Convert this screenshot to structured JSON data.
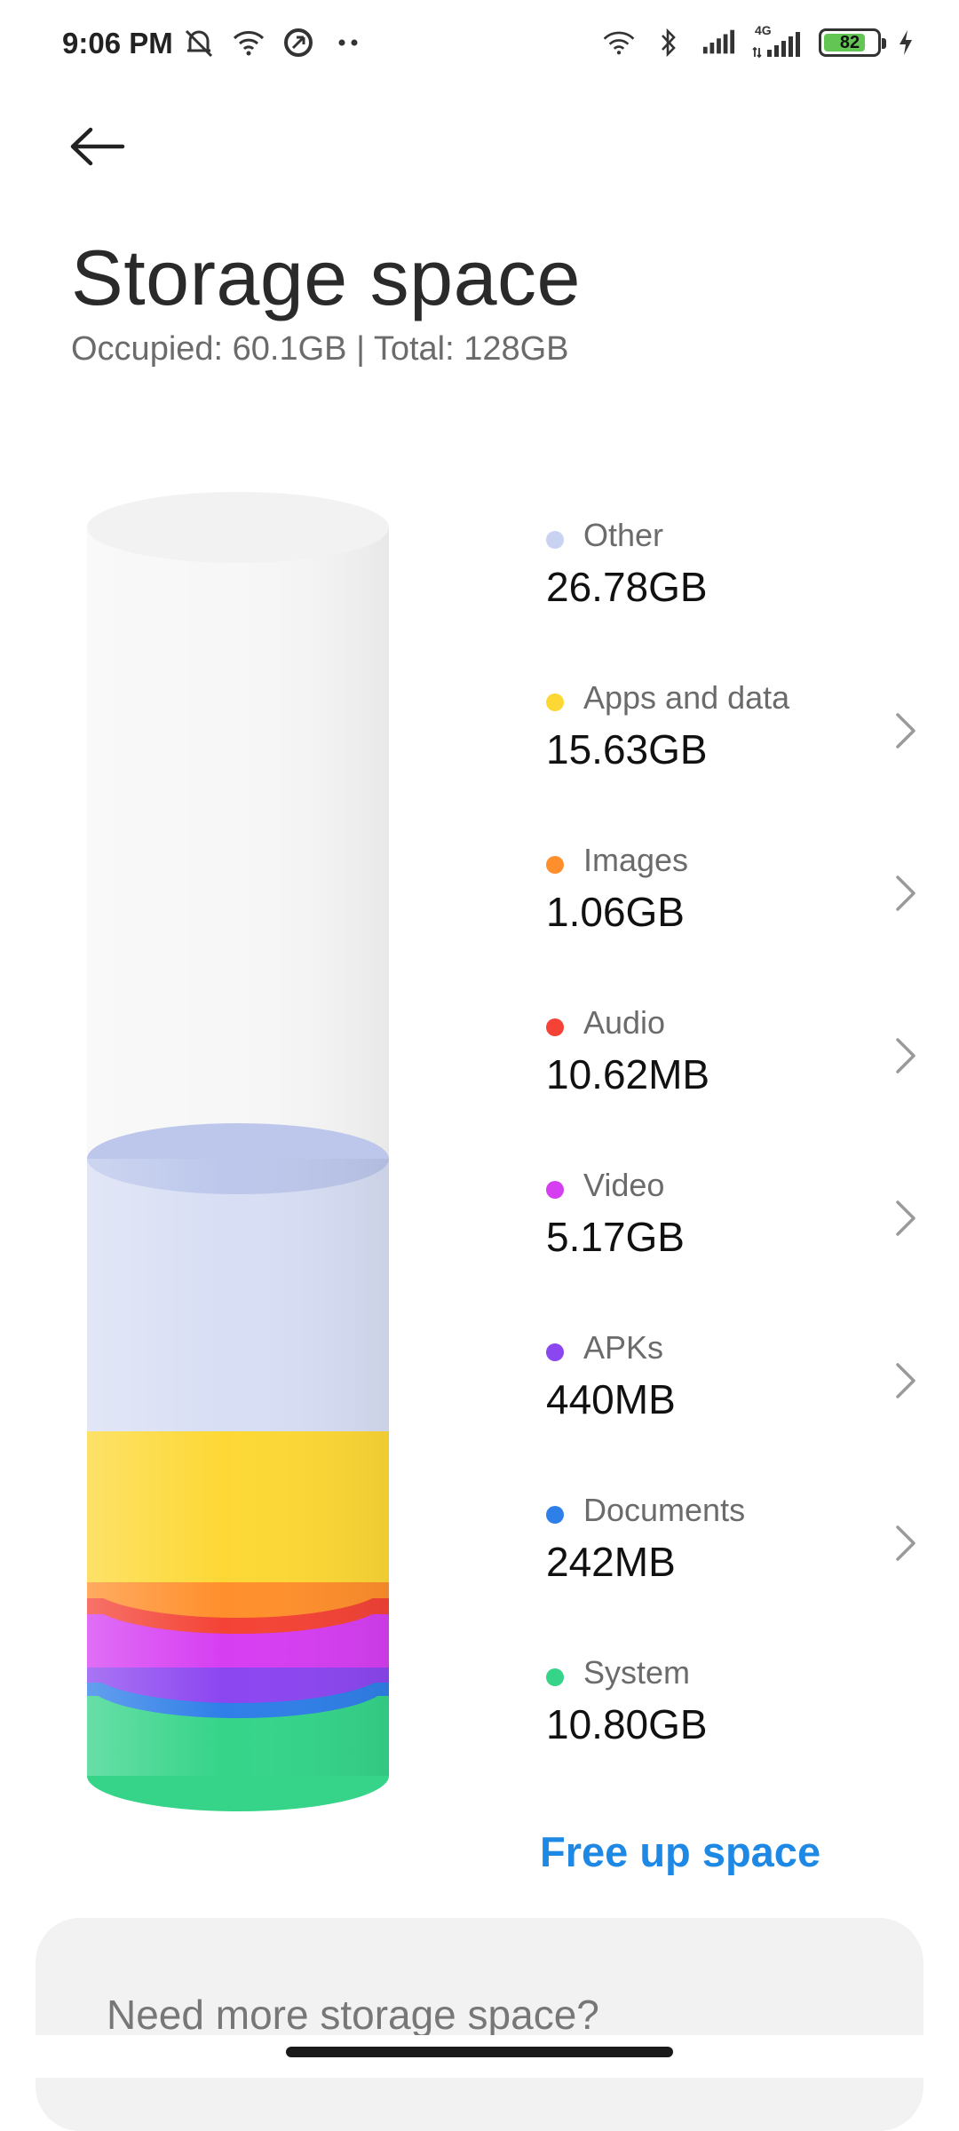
{
  "status_bar": {
    "time": "9:06 PM",
    "network_label": "4G",
    "battery_level": "82",
    "battery_percent": 82,
    "icons_left": [
      "mute-icon",
      "wifi-icon",
      "sync-icon",
      "more-notifications-icon"
    ],
    "icons_right": [
      "wifi-icon",
      "bluetooth-icon",
      "signal-icon",
      "signal-4g-icon",
      "battery-icon",
      "charging-icon"
    ]
  },
  "header": {
    "title": "Storage space",
    "subtitle": "Occupied: 60.1GB | Total: 128GB"
  },
  "legend": [
    {
      "label": "Other",
      "value": "26.78GB",
      "color": "#c9d2f0",
      "chevron": false
    },
    {
      "label": "Apps and data",
      "value": "15.63GB",
      "color": "#fdd835",
      "chevron": true
    },
    {
      "label": "Images",
      "value": "1.06GB",
      "color": "#ff8f2c",
      "chevron": true
    },
    {
      "label": "Audio",
      "value": "10.62MB",
      "color": "#f44336",
      "chevron": true
    },
    {
      "label": "Video",
      "value": "5.17GB",
      "color": "#d63ef2",
      "chevron": true
    },
    {
      "label": "APKs",
      "value": "440MB",
      "color": "#8c46f0",
      "chevron": true
    },
    {
      "label": "Documents",
      "value": "242MB",
      "color": "#2f7fe8",
      "chevron": true
    },
    {
      "label": "System",
      "value": "10.80GB",
      "color": "#35d489",
      "chevron": false
    }
  ],
  "actions": {
    "free_up": "Free up space"
  },
  "promo": {
    "text": "Need more storage space?"
  }
}
